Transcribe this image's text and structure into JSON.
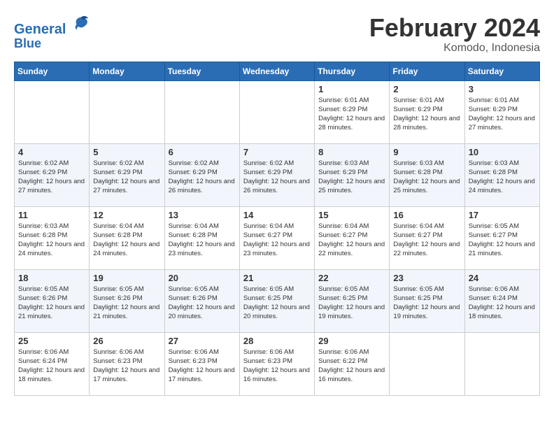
{
  "app": {
    "logo_line1": "General",
    "logo_line2": "Blue"
  },
  "header": {
    "month": "February 2024",
    "location": "Komodo, Indonesia"
  },
  "days_of_week": [
    "Sunday",
    "Monday",
    "Tuesday",
    "Wednesday",
    "Thursday",
    "Friday",
    "Saturday"
  ],
  "weeks": [
    [
      {
        "day": "",
        "sunrise": "",
        "sunset": "",
        "daylight": ""
      },
      {
        "day": "",
        "sunrise": "",
        "sunset": "",
        "daylight": ""
      },
      {
        "day": "",
        "sunrise": "",
        "sunset": "",
        "daylight": ""
      },
      {
        "day": "",
        "sunrise": "",
        "sunset": "",
        "daylight": ""
      },
      {
        "day": "1",
        "sunrise": "6:01 AM",
        "sunset": "6:29 PM",
        "daylight": "12 hours and 28 minutes."
      },
      {
        "day": "2",
        "sunrise": "6:01 AM",
        "sunset": "6:29 PM",
        "daylight": "12 hours and 28 minutes."
      },
      {
        "day": "3",
        "sunrise": "6:01 AM",
        "sunset": "6:29 PM",
        "daylight": "12 hours and 27 minutes."
      }
    ],
    [
      {
        "day": "4",
        "sunrise": "6:02 AM",
        "sunset": "6:29 PM",
        "daylight": "12 hours and 27 minutes."
      },
      {
        "day": "5",
        "sunrise": "6:02 AM",
        "sunset": "6:29 PM",
        "daylight": "12 hours and 27 minutes."
      },
      {
        "day": "6",
        "sunrise": "6:02 AM",
        "sunset": "6:29 PM",
        "daylight": "12 hours and 26 minutes."
      },
      {
        "day": "7",
        "sunrise": "6:02 AM",
        "sunset": "6:29 PM",
        "daylight": "12 hours and 26 minutes."
      },
      {
        "day": "8",
        "sunrise": "6:03 AM",
        "sunset": "6:29 PM",
        "daylight": "12 hours and 25 minutes."
      },
      {
        "day": "9",
        "sunrise": "6:03 AM",
        "sunset": "6:28 PM",
        "daylight": "12 hours and 25 minutes."
      },
      {
        "day": "10",
        "sunrise": "6:03 AM",
        "sunset": "6:28 PM",
        "daylight": "12 hours and 24 minutes."
      }
    ],
    [
      {
        "day": "11",
        "sunrise": "6:03 AM",
        "sunset": "6:28 PM",
        "daylight": "12 hours and 24 minutes."
      },
      {
        "day": "12",
        "sunrise": "6:04 AM",
        "sunset": "6:28 PM",
        "daylight": "12 hours and 24 minutes."
      },
      {
        "day": "13",
        "sunrise": "6:04 AM",
        "sunset": "6:28 PM",
        "daylight": "12 hours and 23 minutes."
      },
      {
        "day": "14",
        "sunrise": "6:04 AM",
        "sunset": "6:27 PM",
        "daylight": "12 hours and 23 minutes."
      },
      {
        "day": "15",
        "sunrise": "6:04 AM",
        "sunset": "6:27 PM",
        "daylight": "12 hours and 22 minutes."
      },
      {
        "day": "16",
        "sunrise": "6:04 AM",
        "sunset": "6:27 PM",
        "daylight": "12 hours and 22 minutes."
      },
      {
        "day": "17",
        "sunrise": "6:05 AM",
        "sunset": "6:27 PM",
        "daylight": "12 hours and 21 minutes."
      }
    ],
    [
      {
        "day": "18",
        "sunrise": "6:05 AM",
        "sunset": "6:26 PM",
        "daylight": "12 hours and 21 minutes."
      },
      {
        "day": "19",
        "sunrise": "6:05 AM",
        "sunset": "6:26 PM",
        "daylight": "12 hours and 21 minutes."
      },
      {
        "day": "20",
        "sunrise": "6:05 AM",
        "sunset": "6:26 PM",
        "daylight": "12 hours and 20 minutes."
      },
      {
        "day": "21",
        "sunrise": "6:05 AM",
        "sunset": "6:25 PM",
        "daylight": "12 hours and 20 minutes."
      },
      {
        "day": "22",
        "sunrise": "6:05 AM",
        "sunset": "6:25 PM",
        "daylight": "12 hours and 19 minutes."
      },
      {
        "day": "23",
        "sunrise": "6:05 AM",
        "sunset": "6:25 PM",
        "daylight": "12 hours and 19 minutes."
      },
      {
        "day": "24",
        "sunrise": "6:06 AM",
        "sunset": "6:24 PM",
        "daylight": "12 hours and 18 minutes."
      }
    ],
    [
      {
        "day": "25",
        "sunrise": "6:06 AM",
        "sunset": "6:24 PM",
        "daylight": "12 hours and 18 minutes."
      },
      {
        "day": "26",
        "sunrise": "6:06 AM",
        "sunset": "6:23 PM",
        "daylight": "12 hours and 17 minutes."
      },
      {
        "day": "27",
        "sunrise": "6:06 AM",
        "sunset": "6:23 PM",
        "daylight": "12 hours and 17 minutes."
      },
      {
        "day": "28",
        "sunrise": "6:06 AM",
        "sunset": "6:23 PM",
        "daylight": "12 hours and 16 minutes."
      },
      {
        "day": "29",
        "sunrise": "6:06 AM",
        "sunset": "6:22 PM",
        "daylight": "12 hours and 16 minutes."
      },
      {
        "day": "",
        "sunrise": "",
        "sunset": "",
        "daylight": ""
      },
      {
        "day": "",
        "sunrise": "",
        "sunset": "",
        "daylight": ""
      }
    ]
  ]
}
